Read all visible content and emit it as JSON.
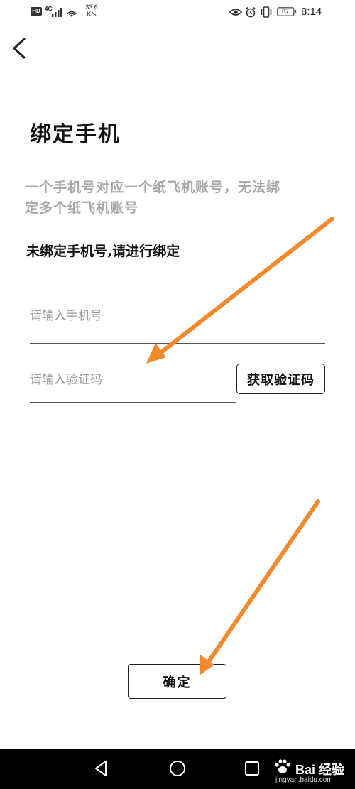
{
  "status_bar": {
    "hd": "HD",
    "network": "4G",
    "speed_value": "33.6",
    "speed_unit": "K/s",
    "battery": "87",
    "time": "8:14",
    "icons": [
      "hd-icon",
      "signal-icon",
      "wifi-hotspot-icon",
      "eye-icon",
      "alarm-icon",
      "vibrate-icon",
      "battery-icon"
    ]
  },
  "header": {
    "back_icon": "chevron-left-icon"
  },
  "page": {
    "title": "绑定手机",
    "description": "一个手机号对应一个纸飞机账号，无法绑定多个纸飞机账号",
    "notice": "未绑定手机号,请进行绑定"
  },
  "form": {
    "phone_placeholder": "请输入手机号",
    "phone_value": "",
    "code_placeholder": "请输入验证码",
    "code_value": "",
    "get_code_label": "获取验证码",
    "confirm_label": "确定"
  },
  "annotations": {
    "arrow_color": "#f2892c"
  },
  "nav_bar": {
    "icons": [
      "nav-back-icon",
      "nav-home-icon",
      "nav-recent-icon"
    ]
  },
  "watermark": {
    "brand": "Bai 经验",
    "url": "jingyan.baidu.com"
  }
}
